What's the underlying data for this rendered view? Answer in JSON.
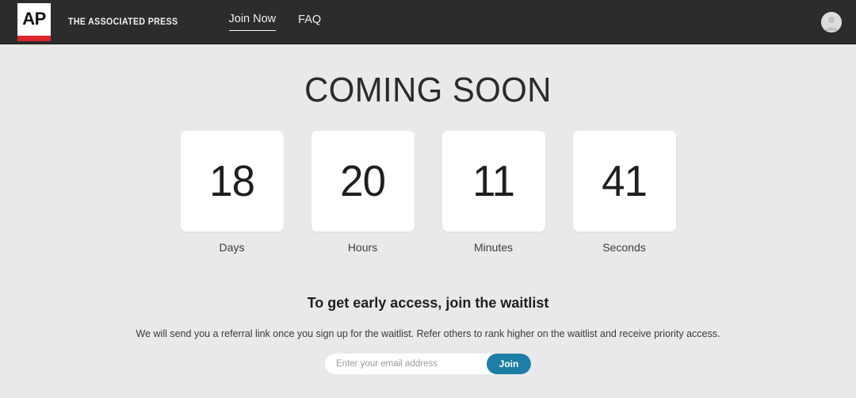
{
  "header": {
    "logo": {
      "text": "AP",
      "accent_color": "#d9262c",
      "icon": "ap-logo-icon"
    },
    "brand_name": "THE ASSOCIATED PRESS",
    "nav": [
      {
        "label": "Join Now",
        "active": true
      },
      {
        "label": "FAQ",
        "active": false
      }
    ],
    "avatar_icon": "user-avatar-icon",
    "background_color": "#2c2c2c"
  },
  "main": {
    "title": "COMING SOON",
    "countdown": [
      {
        "value": "18",
        "label": "Days"
      },
      {
        "value": "20",
        "label": "Hours"
      },
      {
        "value": "11",
        "label": "Minutes"
      },
      {
        "value": "41",
        "label": "Seconds"
      }
    ],
    "waitlist_heading": "To get early access, join the waitlist",
    "waitlist_description": "We will send you a referral link once you sign up for the waitlist. Refer others to rank higher on the waitlist and receive priority access.",
    "signup": {
      "email_placeholder": "Enter your email address",
      "email_value": "",
      "join_label": "Join",
      "join_color": "#1d7ea6"
    },
    "background_color": "#e9e9e9"
  }
}
